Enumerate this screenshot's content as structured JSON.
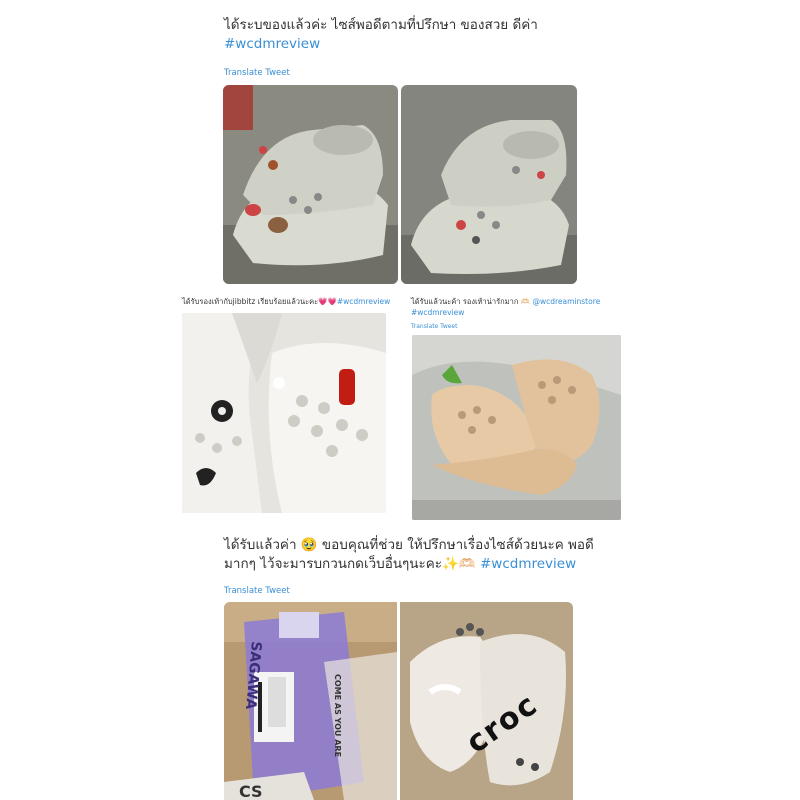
{
  "tweet1": {
    "text": "ได้ระบของแล้วค่ะ ไซส์พอดีตามที่ปรึกษา ของสวย ดีค่า",
    "hashtag": "#wcdmreview",
    "translate": "Translate Tweet",
    "photos": [
      "crocs-left-photo",
      "crocs-right-photo"
    ]
  },
  "tweet2": {
    "text": "ได้รับรองเท้ากับjibbitz เรียบร้อยแล้วนะคะ💗💗",
    "hashtag": "#wcdmreview"
  },
  "tweet3": {
    "text": "ได้รับแล้วนะค้า รองเท้าน่ารักมาก 🫶🏻",
    "mention": "@wcdreaminstore",
    "hashtag": "#wcdmreview",
    "translate": "Translate Tweet"
  },
  "tweet4": {
    "line1": "ได้รับแล้วค่า 🥹 ขอบคุณที่ช่วย ให้ปรึกษาเรื่องไซส์ด้วยนะค พอดี",
    "line2": "มากๆ ไว้จะมารบกวนกดเว็บอื่นๆนะคะ✨🫶🏻",
    "hashtag": "#wcdmreview",
    "translate": "Translate Tweet",
    "package_text": "SAGAWA",
    "bag_text": "COME AS YOU ARE",
    "brand_text": "croc"
  },
  "colors": {
    "hashtag": "#3a8fd6",
    "text": "#333333"
  }
}
